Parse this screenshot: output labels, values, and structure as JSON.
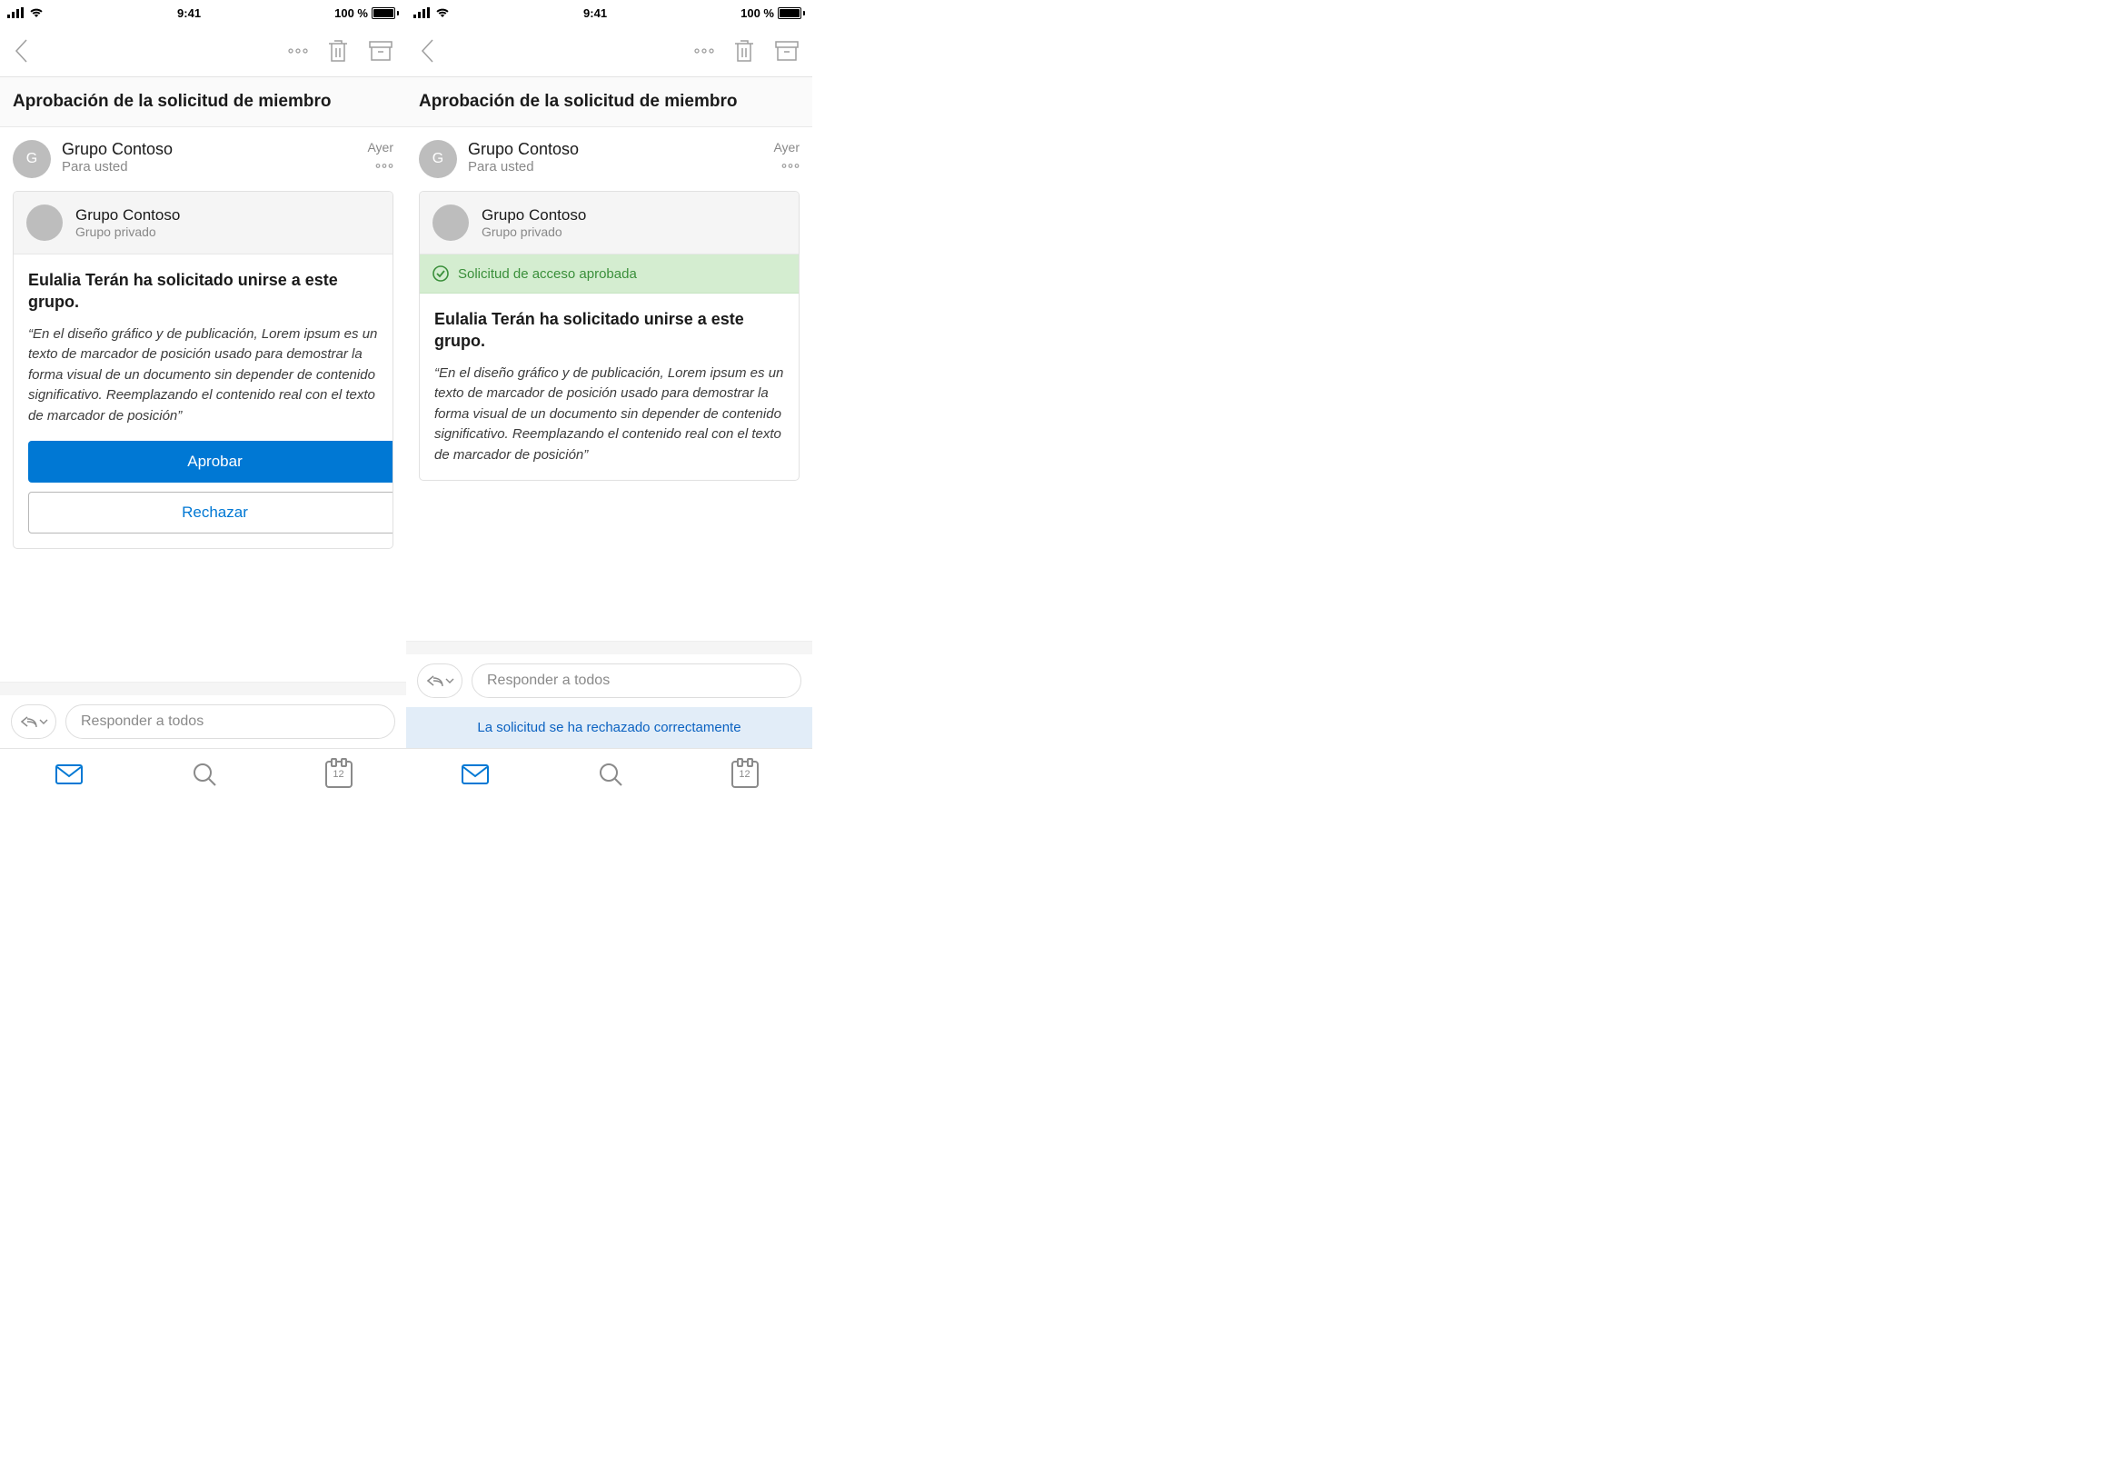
{
  "status": {
    "time": "9:41",
    "battery_text": "100 %"
  },
  "subject": "Aprobación de la solicitud de miembro",
  "message_header": {
    "sender": "Grupo Contoso",
    "recipient": "Para usted",
    "timestamp": "Ayer",
    "avatar_initial": "G"
  },
  "card": {
    "group_name": "Grupo Contoso",
    "group_type": "Grupo privado",
    "success_text": "Solicitud de acceso aprobada",
    "request_title": "Eulalia Terán ha solicitado unirse a este grupo.",
    "request_quote": "“En el diseño gráfico y de publicación, Lorem ipsum es un texto de marcador de posición usado para demostrar la forma visual de un documento sin depender de contenido significativo. Reemplazando el contenido real con el texto de marcador de posición”"
  },
  "buttons": {
    "approve": "Aprobar",
    "reject": "Rechazar"
  },
  "reply": {
    "placeholder": "Responder a todos"
  },
  "toast": {
    "rejected": "La solicitud se ha rechazado correctamente"
  },
  "tabs": {
    "calendar_day": "12"
  }
}
